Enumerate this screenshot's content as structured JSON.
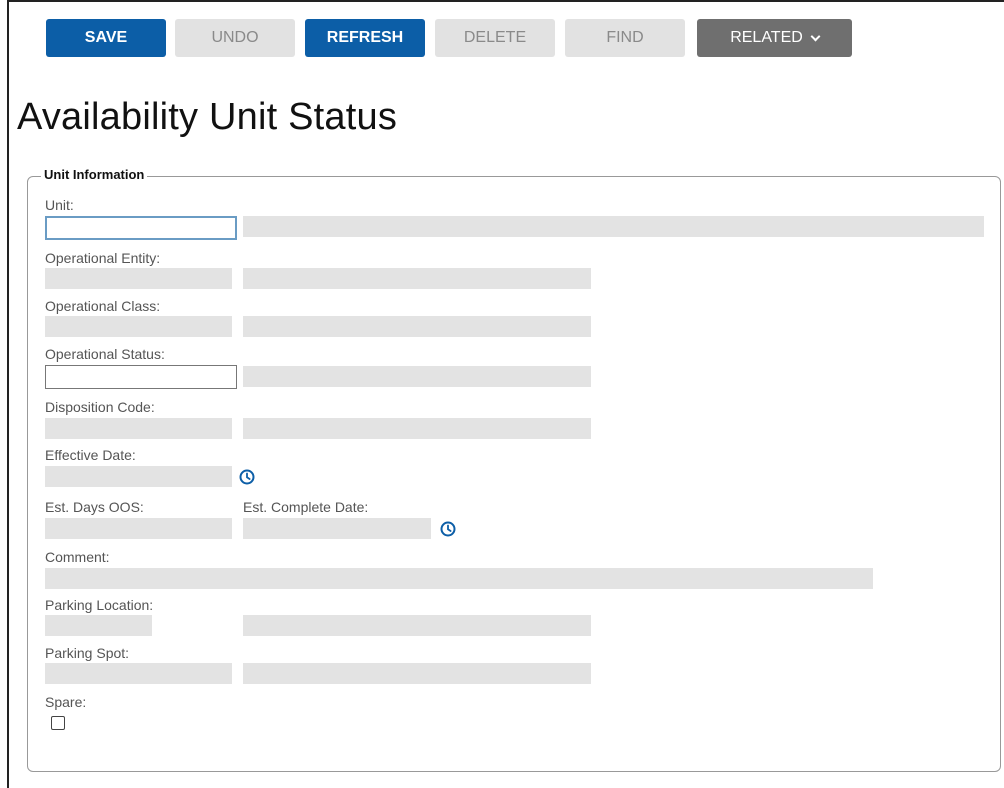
{
  "toolbar": {
    "save": "SAVE",
    "undo": "UNDO",
    "refresh": "REFRESH",
    "delete": "DELETE",
    "find": "FIND",
    "related": "RELATED"
  },
  "page_title": "Availability Unit Status",
  "section_title": "Unit Information",
  "labels": {
    "unit": "Unit:",
    "operational_entity": "Operational Entity:",
    "operational_class": "Operational Class:",
    "operational_status": "Operational Status:",
    "disposition_code": "Disposition Code:",
    "effective_date": "Effective Date:",
    "est_days_oos": "Est. Days OOS:",
    "est_complete_date": "Est. Complete Date:",
    "comment": "Comment:",
    "parking_location": "Parking Location:",
    "parking_spot": "Parking Spot:",
    "spare": "Spare:"
  },
  "values": {
    "unit": "",
    "operational_status": ""
  },
  "colors": {
    "primary": "#0c5ea7",
    "disabled": "#e2e2e2",
    "related": "#6f6f6f",
    "clock": "#0c5ea7"
  },
  "icons": [
    "clock-icon",
    "chevron-down-icon"
  ]
}
